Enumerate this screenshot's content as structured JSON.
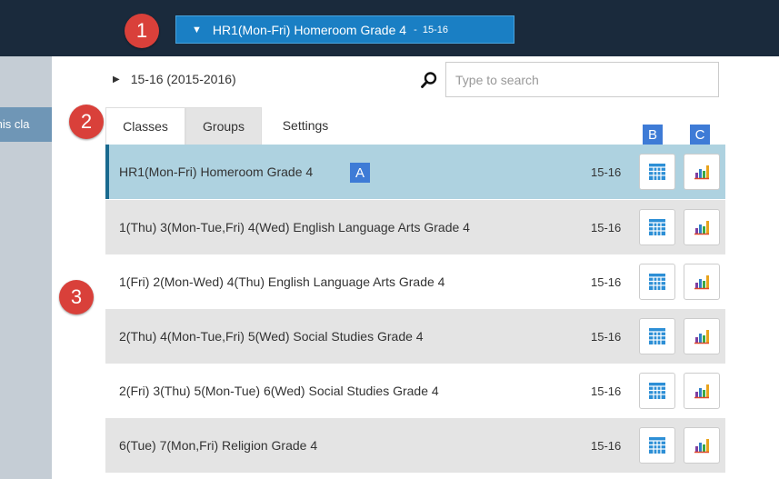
{
  "header": {
    "class_selector": {
      "label": "HR1(Mon-Fri) Homeroom Grade 4",
      "separator": "-",
      "year": "15-16"
    }
  },
  "sidebar": {
    "partial_text": "this cla"
  },
  "panel": {
    "year_toggle": "15-16 (2015-2016)",
    "search": {
      "placeholder": "Type to search",
      "value": ""
    },
    "tabs": [
      {
        "label": "Classes",
        "active": true
      },
      {
        "label": "Groups",
        "active": false
      },
      {
        "label": "Settings",
        "active": false
      }
    ],
    "classes": [
      {
        "name": "HR1(Mon-Fri) Homeroom Grade 4",
        "year": "15-16",
        "selected": true
      },
      {
        "name": "1(Thu) 3(Mon-Tue,Fri) 4(Wed) English Language Arts Grade 4",
        "year": "15-16",
        "selected": false
      },
      {
        "name": "1(Fri) 2(Mon-Wed) 4(Thu) English Language Arts Grade 4",
        "year": "15-16",
        "selected": false
      },
      {
        "name": "2(Thu) 4(Mon-Tue,Fri) 5(Wed) Social Studies Grade 4",
        "year": "15-16",
        "selected": false
      },
      {
        "name": "2(Fri) 3(Thu) 5(Mon-Tue) 6(Wed) Social Studies Grade 4",
        "year": "15-16",
        "selected": false
      },
      {
        "name": "6(Tue) 7(Mon,Fri) Religion Grade 4",
        "year": "15-16",
        "selected": false
      }
    ]
  },
  "callouts": {
    "one": "1",
    "two": "2",
    "three": "3",
    "a": "A",
    "b": "B",
    "c": "C"
  },
  "colors": {
    "topbar": "#1a2a3c",
    "dropdown": "#1a7fc4",
    "selected_row": "#aed2e0",
    "callout_red": "#d9403a",
    "callout_blue": "#3e7bd6"
  },
  "icons": {
    "caret": "triangle-down",
    "year_toggle": "triangle-right",
    "search": "magnifier",
    "row_button_1": "calendar-grid",
    "row_button_2": "bar-chart"
  }
}
